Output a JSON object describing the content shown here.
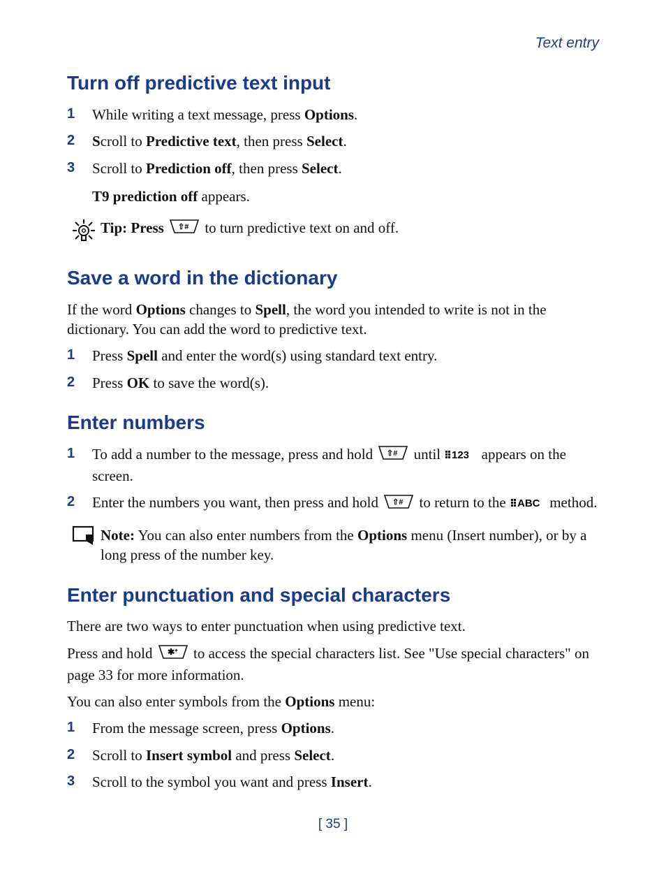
{
  "header": {
    "breadcrumb": "Text entry"
  },
  "s1": {
    "title": "Turn off predictive text input",
    "step1_a": "While writing a text message, press ",
    "step1_b": "Options",
    "step1_c": ".",
    "step2_a": "S",
    "step2_b": "croll to ",
    "step2_c": "Predictive text",
    "step2_d": ", then press ",
    "step2_e": "Select",
    "step2_f": ".",
    "step3_a": "Scroll to ",
    "step3_b": "Prediction off",
    "step3_c": ", then press ",
    "step3_d": "Select",
    "step3_e": ".",
    "result_a": "T9 prediction off",
    "result_b": " appears.",
    "tip_label": "Tip:",
    "tip_a": " Press  ",
    "tip_b": "  to turn predictive text on and off."
  },
  "s2": {
    "title": "Save a word in the dictionary",
    "intro_a": "If the word ",
    "intro_b": "Options",
    "intro_c": " changes to ",
    "intro_d": "Spell",
    "intro_e": ", the word you intended to write is not in the dictionary. You can add the word to predictive text.",
    "step1_a": "Press ",
    "step1_b": "Spell",
    "step1_c": " and enter the word(s) using standard text entry.",
    "step2_a": "Press ",
    "step2_b": "OK",
    "step2_c": " to save the word(s)."
  },
  "s3": {
    "title": "Enter numbers",
    "step1_a": "To add a number to the message, press and hold ",
    "step1_b": " until ",
    "step1_c": " appears on the screen.",
    "step2_a": "Enter the numbers you want, then press and hold ",
    "step2_b": " to return to the ",
    "step2_c": " method.",
    "note_label": "Note:",
    "note_a": "  You can also enter numbers from the ",
    "note_b": "Options",
    "note_c": " menu (Insert number), or by a long press of the number key."
  },
  "s4": {
    "title": "Enter punctuation and special characters",
    "p1": "There are two ways to enter punctuation when using predictive text.",
    "p2_a": "Press and hold ",
    "p2_b": " to access the special characters list. See \"Use special characters\" on page 33 for more information.",
    "p3_a": "You can also enter symbols from the ",
    "p3_b": "Options",
    "p3_c": " menu:",
    "step1_a": "From the message screen, press ",
    "step1_b": "Options",
    "step1_c": ".",
    "step2_a": "Scroll to ",
    "step2_b": "Insert symbol",
    "step2_c": " and press ",
    "step2_d": "Select",
    "step2_e": ".",
    "step3_a": "Scroll to the symbol you want and press ",
    "step3_b": "Insert",
    "step3_c": "."
  },
  "page": {
    "number": "[ 35 ]"
  }
}
